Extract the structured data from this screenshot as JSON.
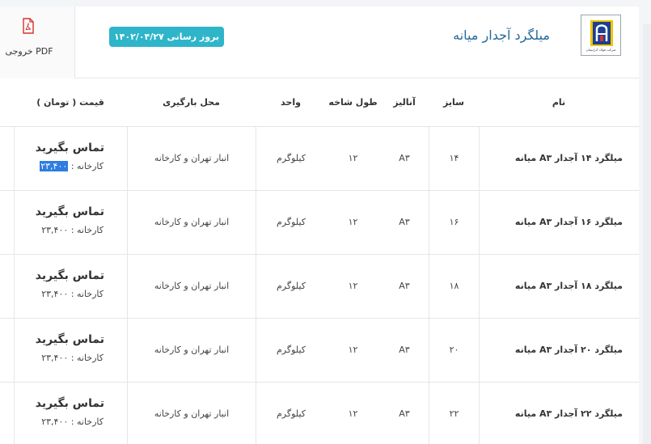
{
  "header": {
    "pdf_label": "خروجی PDF",
    "update_label": "بروز رسانی ۱۴۰۲/۰۴/۲۷",
    "title": "میلگرد آجدار میانه",
    "logo_caption": "شرکت فولاد آذرابیجان"
  },
  "table": {
    "columns": {
      "name": "نام",
      "size": "سایز",
      "analysis": "آنالیز",
      "length": "طول شاخه",
      "unit": "واحد",
      "location": "محل بارگیری",
      "price": "قیمت ( تومان )"
    },
    "rows": [
      {
        "name": "میلگرد ۱۴ آجدار A۳ میانه",
        "size": "۱۴",
        "analysis": "A۳",
        "length": "۱۲",
        "unit": "کیلوگرم",
        "location": "انبار تهران و کارخانه",
        "price_main": "تماس بگیرید",
        "price_sub_label": "کارخانه :",
        "price_sub_value": "۲۳,۴۰۰"
      },
      {
        "name": "میلگرد ۱۶ آجدار A۳ میانه",
        "size": "۱۶",
        "analysis": "A۳",
        "length": "۱۲",
        "unit": "کیلوگرم",
        "location": "انبار تهران و کارخانه",
        "price_main": "تماس بگیرید",
        "price_sub_label": "کارخانه :",
        "price_sub_value": "۲۳,۴۰۰"
      },
      {
        "name": "میلگرد ۱۸ آجدار A۳ میانه",
        "size": "۱۸",
        "analysis": "A۳",
        "length": "۱۲",
        "unit": "کیلوگرم",
        "location": "انبار تهران و کارخانه",
        "price_main": "تماس بگیرید",
        "price_sub_label": "کارخانه :",
        "price_sub_value": "۲۳,۴۰۰"
      },
      {
        "name": "میلگرد ۲۰ آجدار A۳ میانه",
        "size": "۲۰",
        "analysis": "A۳",
        "length": "۱۲",
        "unit": "کیلوگرم",
        "location": "انبار تهران و کارخانه",
        "price_main": "تماس بگیرید",
        "price_sub_label": "کارخانه :",
        "price_sub_value": "۲۳,۴۰۰"
      },
      {
        "name": "میلگرد ۲۲ آجدار A۳ میانه",
        "size": "۲۲",
        "analysis": "A۳",
        "length": "۱۲",
        "unit": "کیلوگرم",
        "location": "انبار تهران و کارخانه",
        "price_main": "تماس بگیرید",
        "price_sub_label": "کارخانه :",
        "price_sub_value": "۲۳,۴۰۰"
      }
    ]
  },
  "icons": {
    "pdf": "pdf-file-icon",
    "logo": "company-logo"
  },
  "colors": {
    "badge": "#2fb5c9",
    "title": "#256a9c",
    "pdf_red": "#d9302c",
    "selection": "#2f7de1"
  }
}
